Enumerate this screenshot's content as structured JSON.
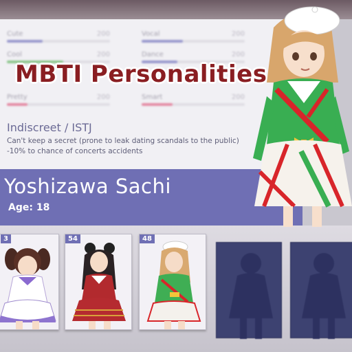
{
  "stats": [
    {
      "label": "Cute",
      "value": "200",
      "fill": 0.35,
      "color": "#7a7ac0"
    },
    {
      "label": "Vocal",
      "value": "200",
      "fill": 0.4,
      "color": "#7a7ac0"
    },
    {
      "label": "Cool",
      "value": "200",
      "fill": 0.55,
      "color": "#6ab86a"
    },
    {
      "label": "Dance",
      "value": "200",
      "fill": 0.35,
      "color": "#7a7ac0"
    },
    {
      "label": "Pretty",
      "value": "200",
      "fill": 0.2,
      "color": "#e06a8a"
    },
    {
      "label": "Smart",
      "value": "200",
      "fill": 0.3,
      "color": "#e06a8a"
    }
  ],
  "title_overlay": "MBTI Personalities",
  "trait": {
    "name": "Indiscreet / ISTJ",
    "line1": "Can't keep a secret (prone to leak dating scandals to the public)",
    "line2": "-10% to chance of concerts accidents"
  },
  "character": {
    "name": "Yoshizawa Sachi",
    "age": "Age: 18"
  },
  "cards": [
    {
      "level": "3",
      "outfit": "white-purple"
    },
    {
      "level": "54",
      "outfit": "red"
    },
    {
      "level": "48",
      "outfit": "green-white"
    }
  ],
  "colors": {
    "accent": "#6f6fb4",
    "title": "#8a1e22",
    "locked_card": "#3d4271"
  }
}
